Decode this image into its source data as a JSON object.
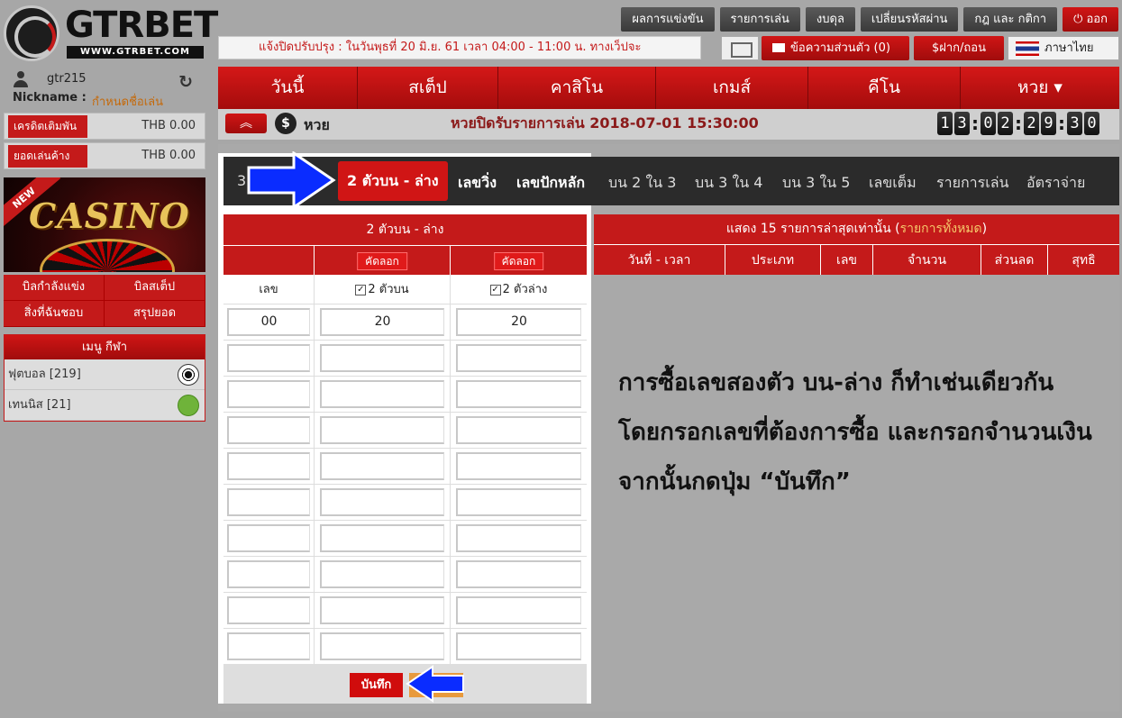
{
  "brand": {
    "name": "GTRBET",
    "url": "WWW.GTRBET.COM"
  },
  "topmenu": [
    {
      "label": "ผลการแข่งขัน"
    },
    {
      "label": "รายการเล่น"
    },
    {
      "label": "งบดุล"
    },
    {
      "label": "เปลี่ยนรหัสผ่าน"
    },
    {
      "label": "กฎ และ กติกา"
    },
    {
      "label": "ออก",
      "icon": "power-icon"
    }
  ],
  "ticker": "แจ้งปิดปรับปรุง : ในวันพุธที่ 20 มิ.ย. 61 เวลา 04:00 - 11:00 น. ทางเว็ปจะ",
  "header_actions": {
    "messages": "ข้อความส่วนตัว (0)",
    "deposit": "ฝาก/ถอน",
    "language": "ภาษาไทย"
  },
  "user": {
    "username": "gtr215",
    "nickname_label": "Nickname :",
    "nickname_value": "กำหนดชื่อเล่น",
    "credit_label": "เครดิตเติมพัน",
    "credit_value": "THB 0.00",
    "outstanding_label": "ยอดเล่นค้าง",
    "outstanding_value": "THB 0.00"
  },
  "promo": {
    "ribbon": "NEW",
    "title": "CASINO"
  },
  "account_links": [
    "บิลกำลังแข่ง",
    "บิลสเต็ป",
    "สิ่งที่ฉันชอบ",
    "สรุปยอด"
  ],
  "sports_menu": {
    "title": "เมนู กีฬา",
    "items": [
      {
        "label": "ฟุตบอล [219]",
        "icon": "soccer-ball-icon"
      },
      {
        "label": "เทนนิส [21]",
        "icon": "tennis-ball-icon"
      }
    ]
  },
  "main_nav": [
    {
      "label": "วันนี้"
    },
    {
      "label": "สเต็ป"
    },
    {
      "label": "คาสิโน"
    },
    {
      "label": "เกมส์"
    },
    {
      "label": "คีโน"
    },
    {
      "label": "หวย ▾"
    }
  ],
  "lotto_bar": {
    "label": "หวย",
    "closing": "หวยปิดรับรายการเล่น 2018-07-01 15:30:00",
    "timer_digits": [
      "1",
      "3",
      "0",
      "2",
      "2",
      "9",
      "3",
      "0"
    ]
  },
  "bet_tabs": [
    {
      "label": "3",
      "state": "dim"
    },
    {
      "label": "2 ตัวบน - ล่าง",
      "state": "active"
    },
    {
      "label": "เลขวิ่ง",
      "state": "normal"
    },
    {
      "label": "เลขปักหลัก",
      "state": "normal"
    },
    {
      "label": "บน 2 ใน 3",
      "state": "dim"
    },
    {
      "label": "บน 3 ใน 4",
      "state": "dim"
    },
    {
      "label": "บน 3 ใน 5",
      "state": "dim"
    },
    {
      "label": "เลขเต็ม",
      "state": "dim"
    },
    {
      "label": "รายการเล่น",
      "state": "dim"
    },
    {
      "label": "อัตราจ่าย",
      "state": "dim"
    }
  ],
  "bet_form": {
    "title": "2 ตัวบน - ล่าง",
    "copy_label": "คัดลอก",
    "col_number": "เลข",
    "col_top": "2 ตัวบน",
    "col_bottom": "2 ตัวล่าง",
    "check_mark": "✓",
    "rows": [
      {
        "number": "00",
        "top": "20",
        "bottom": "20"
      },
      {
        "number": "",
        "top": "",
        "bottom": ""
      },
      {
        "number": "",
        "top": "",
        "bottom": ""
      },
      {
        "number": "",
        "top": "",
        "bottom": ""
      },
      {
        "number": "",
        "top": "",
        "bottom": ""
      },
      {
        "number": "",
        "top": "",
        "bottom": ""
      },
      {
        "number": "",
        "top": "",
        "bottom": ""
      },
      {
        "number": "",
        "top": "",
        "bottom": ""
      },
      {
        "number": "",
        "top": "",
        "bottom": ""
      },
      {
        "number": "",
        "top": "",
        "bottom": ""
      }
    ],
    "save_label": "บันทึก"
  },
  "history": {
    "title_prefix": "แสดง 15 รายการล่าสุดเท่านั้น (",
    "title_link": "รายการทั้งหมด",
    "title_suffix": ")",
    "columns": [
      "วันที่ - เวลา",
      "ประเภท",
      "เลข",
      "จำนวน",
      "ส่วนลด",
      "สุทธิ"
    ]
  },
  "instructions": [
    "การซื้อเลขสองตัว บน-ล่าง ก็ทำเช่นเดียวกัน",
    "โดยกรอกเลขที่ต้องการซื้อ และกรอกจำนวนเงิน",
    "จากนั้นกดปุ่ม “บันทึก”"
  ],
  "colors": {
    "accent": "#c41a1a",
    "arrow": "#0a2cff"
  }
}
